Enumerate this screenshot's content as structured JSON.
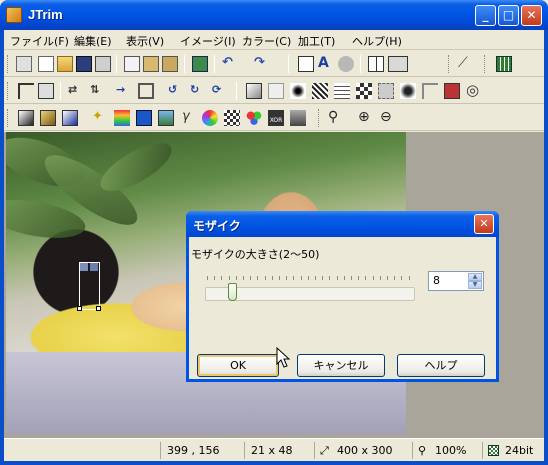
{
  "window": {
    "title": "JTrim",
    "minimize": "_",
    "maximize": "□",
    "close": "✕"
  },
  "menu": [
    "ファイル(F)",
    "編集(E)",
    "表示(V)",
    "イメージ(I)",
    "カラー(C)",
    "加工(T)",
    "ヘルプ(H)"
  ],
  "toolbars": {
    "row1": [
      "clipboard-new-icon",
      "new-file-icon",
      "open-folder-icon",
      "save-icon",
      "print-icon",
      "copy-icon",
      "paste-icon",
      "paste-new-icon",
      "paint-bucket-icon",
      "undo-icon",
      "redo-icon",
      "fit-window-icon",
      "text-icon",
      "shape-icon",
      "grid-view-icon",
      "strip-icon",
      "eyedropper-icon",
      "color-grid-icon"
    ],
    "row2": [
      "crop-icon",
      "resize-icon",
      "flip-horizontal-icon",
      "flip-vertical-icon",
      "shrink-icon",
      "frame-icon",
      "rotate-ccw-icon",
      "rotate-cw-icon",
      "rotate-free-icon",
      "shadow-icon",
      "border-icon",
      "sharpen-icon",
      "noise-icon",
      "wave-icon",
      "mosaic-icon",
      "blur-icon",
      "emboss-icon",
      "relief-icon",
      "edit-icon",
      "swirl-icon"
    ],
    "row3": [
      "dark-icon",
      "sepia-icon",
      "gradient-icon",
      "star-icon",
      "rainbow-icon",
      "blue-square-icon",
      "photo-icon",
      "gamma-icon",
      "color-wheel-icon",
      "checker-icon",
      "rgb-icon",
      "xor-icon",
      "gray-icon",
      "zoom-menu-icon",
      "zoom-in-icon",
      "zoom-out-icon"
    ]
  },
  "status": {
    "cursor_pos": "399 , 156",
    "selection_size": "21 x 48",
    "image_size": "400 x 300",
    "zoom": "100%",
    "depth": "24bit"
  },
  "dialog": {
    "title": "モザイク",
    "label": "モザイクの大きさ(2～50)",
    "value": "8",
    "range_min": 2,
    "range_max": 50,
    "ok_label": "OK",
    "cancel_label": "キャンセル",
    "help_label": "ヘルプ"
  }
}
